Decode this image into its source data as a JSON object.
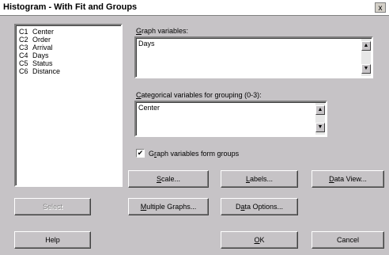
{
  "window": {
    "title": "Histogram - With Fit and Groups",
    "close_glyph": "x"
  },
  "variables": [
    {
      "col": "C1",
      "name": "Center"
    },
    {
      "col": "C2",
      "name": "Order"
    },
    {
      "col": "C3",
      "name": "Arrival"
    },
    {
      "col": "C4",
      "name": "Days"
    },
    {
      "col": "C5",
      "name": "Status"
    },
    {
      "col": "C6",
      "name": "Distance"
    }
  ],
  "graph_vars": {
    "label_mnemonic": "G",
    "label_rest": "raph variables:",
    "value": "Days"
  },
  "cat_vars": {
    "label_mnemonic": "C",
    "label_rest": "ategorical variables for grouping (0-3):",
    "value": "Center"
  },
  "graph_form_groups": {
    "checked": true,
    "check_glyph": "✔",
    "label_pre": "G",
    "label_mnemonic": "r",
    "label_rest": "aph variables form groups"
  },
  "buttons": {
    "scale": {
      "mnemonic": "S",
      "rest": "cale..."
    },
    "labels": {
      "mnemonic": "L",
      "rest": "abels..."
    },
    "data_view": {
      "mnemonic": "D",
      "rest": "ata View..."
    },
    "select": {
      "label": "Select"
    },
    "multiple_graphs": {
      "mnemonic": "M",
      "rest": "ultiple Graphs..."
    },
    "data_options": {
      "pre": "D",
      "mnemonic": "a",
      "rest": "ta Options..."
    },
    "help": {
      "label": "Help"
    },
    "ok": {
      "mnemonic": "O",
      "rest": "K"
    },
    "cancel": {
      "label": "Cancel"
    }
  },
  "scroll_glyphs": {
    "up": "▲",
    "down": "▼"
  }
}
